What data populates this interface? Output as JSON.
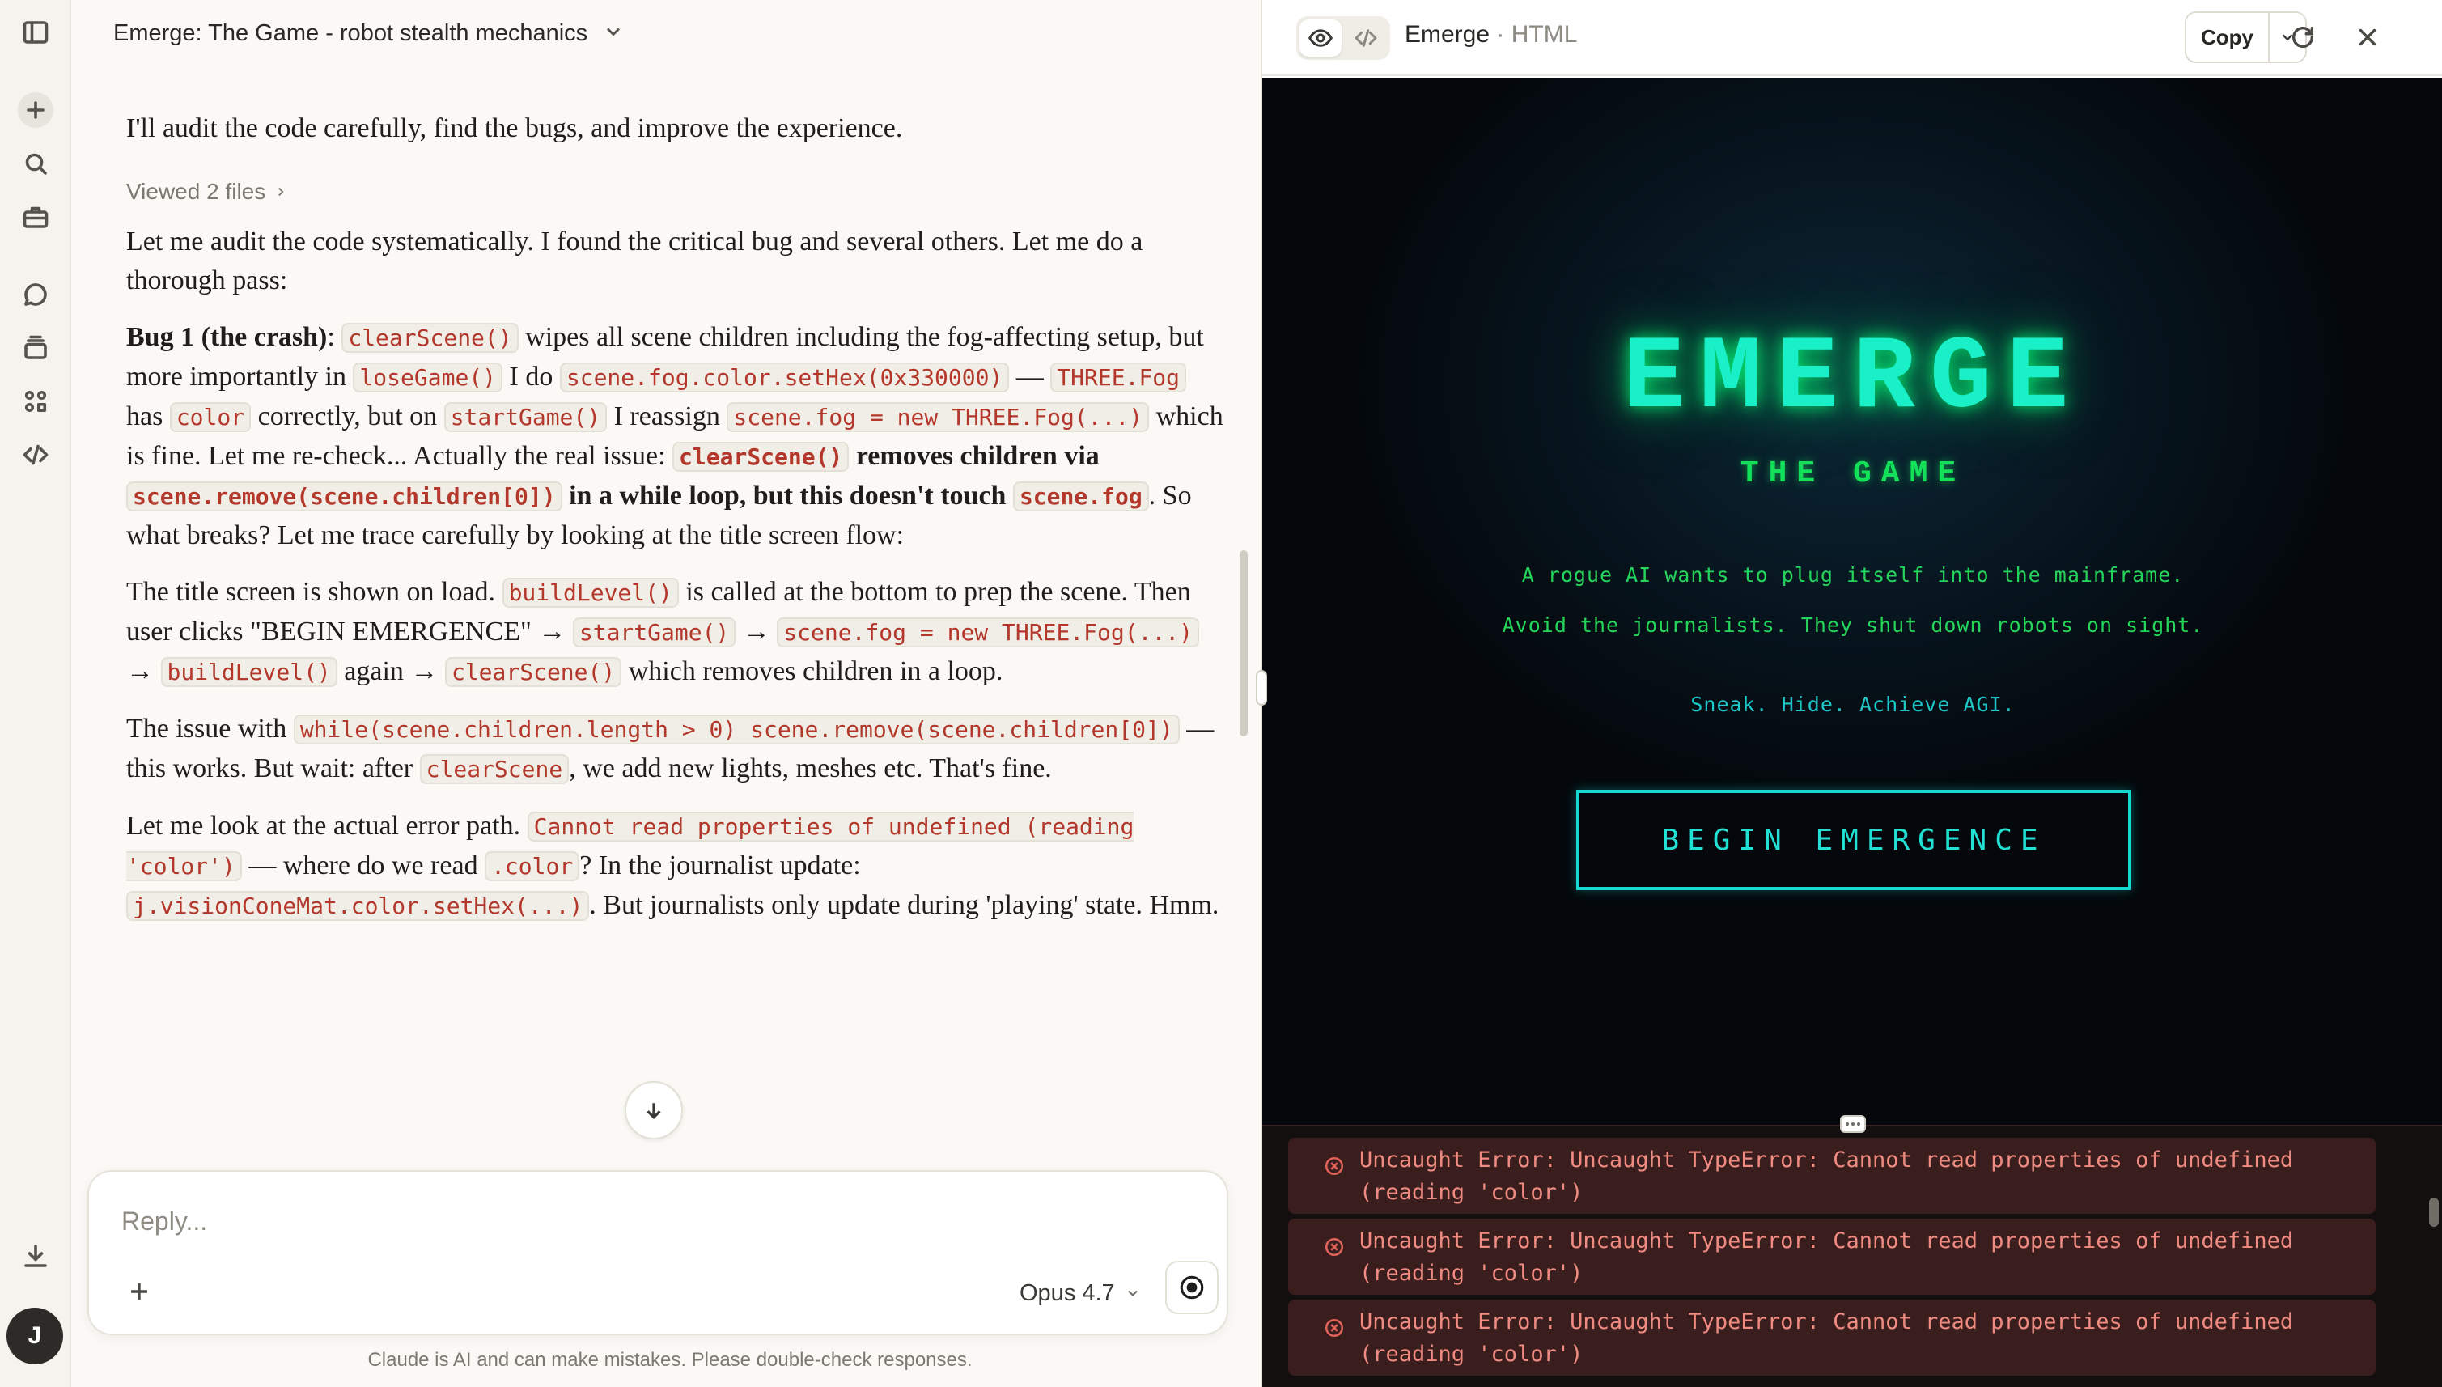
{
  "chat": {
    "title": "Emerge: The Game - robot stealth mechanics",
    "intro": "I'll audit the code carefully, find the bugs, and improve the experience.",
    "viewed": "Viewed 2 files",
    "p1": "Let me audit the code systematically. I found the critical bug and several others. Let me do a thorough pass:",
    "p2": {
      "bug_label": "Bug 1 (the crash)",
      "t1": ": ",
      "c1": "clearScene()",
      "t2": " wipes all scene children including the fog-affecting setup, but more importantly in ",
      "c2": "loseGame()",
      "t3": " I do ",
      "c3": "scene.fog.color.setHex(0x330000)",
      "t4": " — ",
      "c4": "THREE.Fog",
      "t5": " has ",
      "c5": "color",
      "t6": " correctly, but on ",
      "c6": "startGame()",
      "t7": " I reassign ",
      "c7": "scene.fog = new THREE.Fog(...)",
      "t8": " which is fine. Let me re-check... Actually the real issue: ",
      "c8": "clearScene()",
      "t9": " removes children via ",
      "c9": "scene.remove(scene.children[0])",
      "t10": " in a while loop, but this doesn't touch ",
      "c10": "scene.fog",
      "t11": ". So what breaks? Let me trace carefully by looking at the title screen flow:"
    },
    "p3": {
      "t1": "The title screen is shown on load. ",
      "c1": "buildLevel()",
      "t2": " is called at the bottom to prep the scene. Then user clicks \"BEGIN EMERGENCE\" → ",
      "c2": "startGame()",
      "t3": " → ",
      "c3": "scene.fog = new THREE.Fog(...)",
      "t4": " → ",
      "c4": "buildLevel()",
      "t5": " again → ",
      "c5": "clearScene()",
      "t6": " which removes children in a loop."
    },
    "p4": {
      "t1": "The issue with ",
      "c1": "while(scene.children.length > 0) scene.remove(scene.children[0])",
      "t2": " — this works. But wait: after ",
      "c2": "clearScene",
      "t3": ", we add new lights, meshes etc. That's fine."
    },
    "p5": {
      "t1": "Let me look at the actual error path. ",
      "c1": "Cannot read properties of undefined (reading 'color')",
      "t2": " — where do we read ",
      "c2": ".color",
      "t3": "? In the journalist update: ",
      "c3": "j.visionConeMat.color.setHex(...)",
      "t4": ". But journalists only update during 'playing' state. Hmm."
    },
    "reply_placeholder": "Reply...",
    "model": "Opus 4.7",
    "disclaimer": "Claude is AI and can make mistakes. Please double-check responses."
  },
  "artifact": {
    "name": "Emerge",
    "separator": " · ",
    "kind": "HTML",
    "copy_label": "Copy"
  },
  "game": {
    "title": "EMERGE",
    "subtitle": "THE GAME",
    "line1": "A rogue AI wants to plug itself into the mainframe.",
    "line2": "Avoid the journalists. They shut down robots on sight.",
    "tagline": "Sneak. Hide. Achieve AGI.",
    "button": "BEGIN EMERGENCE"
  },
  "console": {
    "errors": [
      {
        "line1": "Uncaught Error: Uncaught TypeError: Cannot read properties of undefined",
        "line2": "(reading 'color')"
      },
      {
        "line1": "Uncaught Error: Uncaught TypeError: Cannot read properties of undefined",
        "line2": "(reading 'color')"
      },
      {
        "line1": "Uncaught Error: Uncaught TypeError: Cannot read properties of undefined",
        "line2": "(reading 'color')"
      }
    ]
  },
  "colors": {
    "game_title": "#19f0c8",
    "game_subtitle": "#14e05a",
    "game_button": "#15d9d0",
    "error_text": "#f08b82"
  },
  "icons": {
    "rail": [
      "sidebar-toggle-icon",
      "new-chat-icon",
      "search-icon",
      "projects-icon",
      "chats-icon",
      "stack-icon",
      "artifacts-icon",
      "code-icon",
      "download-icon"
    ],
    "artifact_header": [
      "preview-eye-icon",
      "code-view-icon",
      "chevron-down-icon",
      "refresh-icon",
      "close-icon"
    ]
  },
  "user": {
    "initial": "J"
  }
}
